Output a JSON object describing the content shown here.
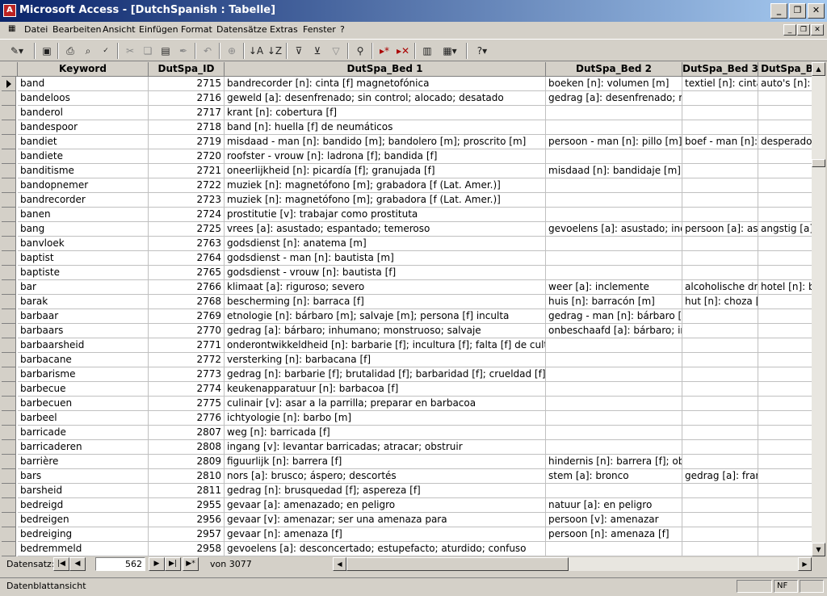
{
  "window": {
    "title": "Microsoft Access - [DutchSpanish : Tabelle]",
    "app_icon_glyph": "A",
    "controls": [
      "_",
      "❐",
      "✕"
    ]
  },
  "menu": [
    "Datei",
    "Bearbeiten",
    "Ansicht",
    "Einfügen",
    "Format",
    "Datensätze",
    "Extras",
    "Fenster",
    "?"
  ],
  "columns": [
    "Keyword",
    "DutSpa_ID",
    "DutSpa_Bed 1",
    "DutSpa_Bed 2",
    "DutSpa_Bed 3",
    "DutSpa_Be"
  ],
  "rows": [
    [
      "band",
      "2715",
      "bandrecorder [n]: cinta [f] magnetofónica",
      "boeken [n]: volumen [m]",
      "textiel [n]: cinta",
      "auto's [n]: n"
    ],
    [
      "bandeloos",
      "2716",
      "geweld [a]: desenfrenado; sin control; alocado; desatado",
      "gedrag [a]: desenfrenado; no",
      "",
      ""
    ],
    [
      "banderol",
      "2717",
      "krant [n]: cobertura [f]",
      "",
      "",
      ""
    ],
    [
      "bandespoor",
      "2718",
      "band [n]: huella [f] de neumáticos",
      "",
      "",
      ""
    ],
    [
      "bandiet",
      "2719",
      "misdaad - man [n]: bandido [m]; bandolero [m]; proscrito [m]",
      "persoon - man [n]: pillo [m];",
      "boef - man [n]:",
      "desperado"
    ],
    [
      "bandiete",
      "2720",
      "roofster - vrouw [n]: ladrona [f]; bandida [f]",
      "",
      "",
      ""
    ],
    [
      "banditisme",
      "2721",
      "oneerlijkheid [n]: picardía [f]; granujada [f]",
      "misdaad [n]: bandidaje [m]; b",
      "",
      ""
    ],
    [
      "bandopnemer",
      "2722",
      "muziek [n]: magnetófono [m]; grabadora [f (Lat. Amer.)]",
      "",
      "",
      ""
    ],
    [
      "bandrecorder",
      "2723",
      "muziek [n]: magnetófono [m]; grabadora [f (Lat. Amer.)]",
      "",
      "",
      ""
    ],
    [
      "banen",
      "2724",
      "prostitutie [v]: trabajar como prostituta",
      "",
      "",
      ""
    ],
    [
      "bang",
      "2725",
      "vrees [a]: asustado; espantado; temeroso",
      "gevoelens [a]: asustado; inqu",
      "persoon [a]: asu",
      "angstig [a]:"
    ],
    [
      "banvloek",
      "2763",
      "godsdienst [n]: anatema [m]",
      "",
      "",
      ""
    ],
    [
      "baptist",
      "2764",
      "godsdienst - man [n]: bautista [m]",
      "",
      "",
      ""
    ],
    [
      "baptiste",
      "2765",
      "godsdienst - vrouw [n]: bautista [f]",
      "",
      "",
      ""
    ],
    [
      "bar",
      "2766",
      "klimaat [a]: riguroso; severo",
      "weer [a]: inclemente",
      "alcoholische dra",
      "hotel [n]: ba"
    ],
    [
      "barak",
      "2768",
      "bescherming [n]: barraca [f]",
      "huis [n]: barracón [m]",
      "hut [n]: choza [f",
      ""
    ],
    [
      "barbaar",
      "2769",
      "etnologie [n]: bárbaro [m]; salvaje [m]; persona [f] inculta",
      "gedrag - man [n]: bárbaro [m",
      "",
      ""
    ],
    [
      "barbaars",
      "2770",
      "gedrag [a]: bárbaro; inhumano; monstruoso; salvaje",
      "onbeschaafd [a]: bárbaro; inc",
      "",
      ""
    ],
    [
      "barbaarsheid",
      "2771",
      "onderontwikkeldheid [n]: barbarie [f]; incultura [f]; falta [f] de cultura",
      "",
      "",
      ""
    ],
    [
      "barbacane",
      "2772",
      "versterking [n]: barbacana [f]",
      "",
      "",
      ""
    ],
    [
      "barbarisme",
      "2773",
      "gedrag [n]: barbarie [f]; brutalidad [f]; barbaridad [f]; crueldad [f]; best",
      "",
      "",
      ""
    ],
    [
      "barbecue",
      "2774",
      "keukenapparatuur [n]: barbacoa [f]",
      "",
      "",
      ""
    ],
    [
      "barbecuen",
      "2775",
      "culinair [v]: asar a la parrilla; preparar en barbacoa",
      "",
      "",
      ""
    ],
    [
      "barbeel",
      "2776",
      "ichtyologie [n]: barbo [m]",
      "",
      "",
      ""
    ],
    [
      "barricade",
      "2807",
      "weg [n]: barricada [f]",
      "",
      "",
      ""
    ],
    [
      "barricaderen",
      "2808",
      "ingang [v]: levantar barricadas; atracar; obstruir",
      "",
      "",
      ""
    ],
    [
      "barrière",
      "2809",
      "figuurlijk [n]: barrera [f]",
      "hindernis [n]: barrera [f]; obst",
      "",
      ""
    ],
    [
      "bars",
      "2810",
      "nors [a]: brusco; áspero; descortés",
      "stem [a]: bronco",
      "gedrag [a]: franc",
      ""
    ],
    [
      "barsheid",
      "2811",
      "gedrag [n]: brusquedad [f]; aspereza [f]",
      "",
      "",
      ""
    ],
    [
      "bedreigd",
      "2955",
      "gevaar [a]: amenazado; en peligro",
      "natuur [a]: en peligro",
      "",
      ""
    ],
    [
      "bedreigen",
      "2956",
      "gevaar [v]: amenazar; ser una amenaza para",
      "persoon [v]: amenazar",
      "",
      ""
    ],
    [
      "bedreiging",
      "2957",
      "gevaar [n]: amenaza [f]",
      "persoon [n]: amenaza [f]",
      "",
      ""
    ],
    [
      "bedremmeld",
      "2958",
      "gevoelens [a]: desconcertado; estupefacto; aturdido; confuso",
      "",
      "",
      ""
    ]
  ],
  "navigation": {
    "label": "Datensatz:",
    "current_record": "562",
    "of_label": "von 3077"
  },
  "status": {
    "text": "Datenblattansicht",
    "indicator": "NF"
  }
}
